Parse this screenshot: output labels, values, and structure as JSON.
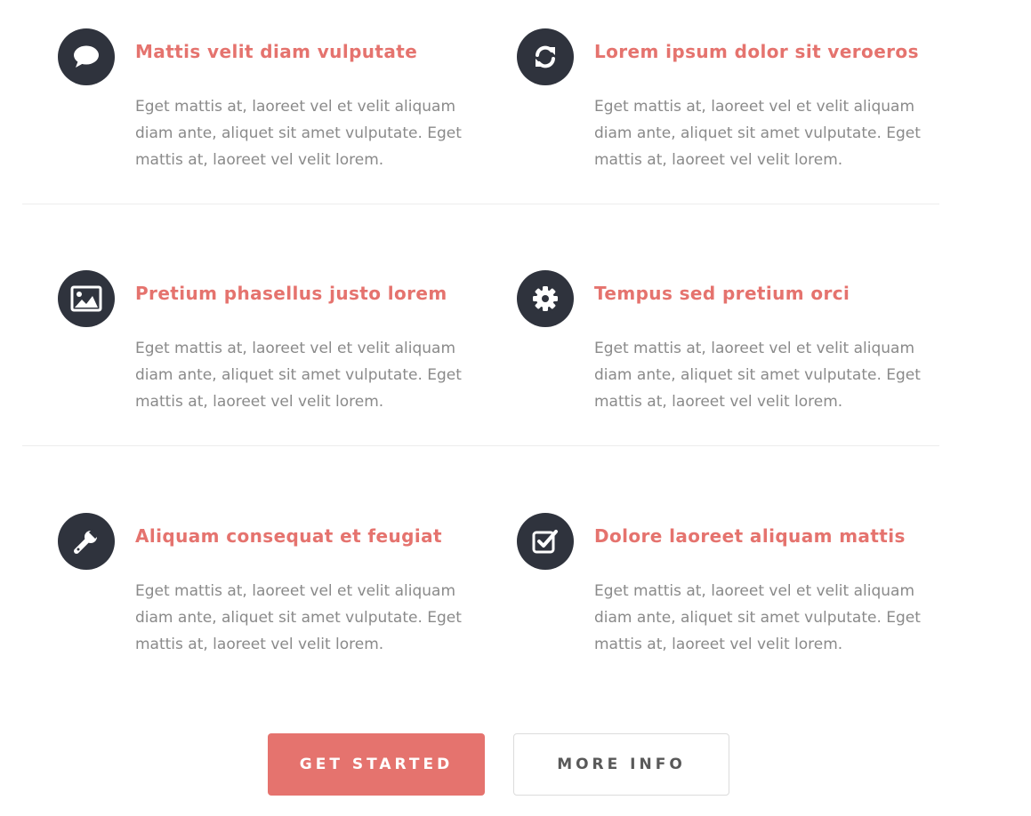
{
  "features": [
    {
      "icon": "comment-icon",
      "title": "Mattis velit diam vulputate",
      "text": "Eget mattis at, laoreet vel et velit aliquam diam ante, aliquet sit amet vulputate. Eget mattis at, laoreet vel velit lorem."
    },
    {
      "icon": "refresh-icon",
      "title": "Lorem ipsum dolor sit veroeros",
      "text": "Eget mattis at, laoreet vel et velit aliquam diam ante, aliquet sit amet vulputate. Eget mattis at, laoreet vel velit lorem."
    },
    {
      "icon": "image-icon",
      "title": "Pretium phasellus justo lorem",
      "text": "Eget mattis at, laoreet vel et velit aliquam diam ante, aliquet sit amet vulputate. Eget mattis at, laoreet vel velit lorem."
    },
    {
      "icon": "gear-icon",
      "title": "Tempus sed pretium orci",
      "text": "Eget mattis at, laoreet vel et velit aliquam diam ante, aliquet sit amet vulputate. Eget mattis at, laoreet vel velit lorem."
    },
    {
      "icon": "wrench-icon",
      "title": "Aliquam consequat et feugiat",
      "text": "Eget mattis at, laoreet vel et velit aliquam diam ante, aliquet sit amet vulputate. Eget mattis at, laoreet vel velit lorem."
    },
    {
      "icon": "checkbox-icon",
      "title": "Dolore laoreet aliquam mattis",
      "text": "Eget mattis at, laoreet vel et velit aliquam diam ante, aliquet sit amet vulputate. Eget mattis at, laoreet vel velit lorem."
    }
  ],
  "actions": {
    "primary_label": "GET STARTED",
    "secondary_label": "MORE INFO"
  },
  "colors": {
    "accent": "#e5736e",
    "icon_bg": "#2f333d",
    "body_text": "#8a8a8a",
    "divider": "#ececec"
  }
}
